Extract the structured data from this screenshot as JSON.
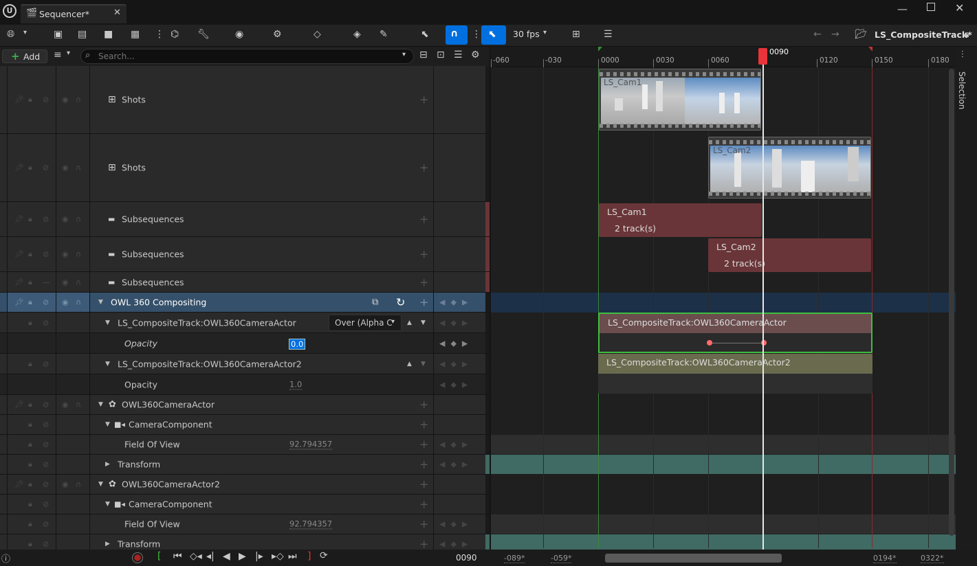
{
  "window": {
    "tab_title": "Sequencer*",
    "app_icon": "unreal-logo-icon"
  },
  "toolbar": {
    "fps": "30 fps",
    "breadcrumb": "LS_CompositeTrack*"
  },
  "search": {
    "add_label": "Add",
    "placeholder": "Search..."
  },
  "tracks": [
    {
      "label": "Shots"
    },
    {
      "label": "Shots"
    },
    {
      "label": "Subsequences"
    },
    {
      "label": "Subsequences"
    },
    {
      "label": "Subsequences"
    },
    {
      "label": "OWL 360 Compositing"
    },
    {
      "label": "LS_CompositeTrack:OWL360CameraActor",
      "blend": "Over (Alpha C"
    },
    {
      "label": "Opacity",
      "value": "0.0"
    },
    {
      "label": "LS_CompositeTrack:OWL360CameraActor2"
    },
    {
      "label": "Opacity",
      "value": "1.0"
    },
    {
      "label": "OWL360CameraActor"
    },
    {
      "label": "CameraComponent"
    },
    {
      "label": "Field Of View",
      "value": "92.794357"
    },
    {
      "label": "Transform"
    },
    {
      "label": "OWL360CameraActor2"
    },
    {
      "label": "CameraComponent"
    },
    {
      "label": "Field Of View",
      "value": "92.794357"
    },
    {
      "label": "Transform"
    }
  ],
  "ruler": {
    "ticks": [
      "-060",
      "-030",
      "0000",
      "0030",
      "0060",
      "0120",
      "0150",
      "0180"
    ],
    "playhead": "0090"
  },
  "clips": {
    "shot1": "LS_Cam1",
    "shot2": "LS_Cam2",
    "sub1_name": "LS_Cam1",
    "sub1_tracks": "2 track(s)",
    "sub2_name": "LS_Cam2",
    "sub2_tracks": "2 track(s)",
    "comp1": "LS_CompositeTrack:OWL360CameraActor",
    "comp2": "LS_CompositeTrack:OWL360CameraActor2"
  },
  "sidebar": {
    "selection": "Selection"
  },
  "bottom": {
    "frame": "0090",
    "range_start": "-089*",
    "view_start": "-059*",
    "view_end": "0194*",
    "range_end": "0322*"
  },
  "colors": {
    "accent": "#0070e0",
    "playhead": "#e8343a",
    "subsequence": "#6a3538",
    "composite1": "#6b4d4d",
    "composite2": "#6a6a4e",
    "transform": "#3f6b64"
  }
}
